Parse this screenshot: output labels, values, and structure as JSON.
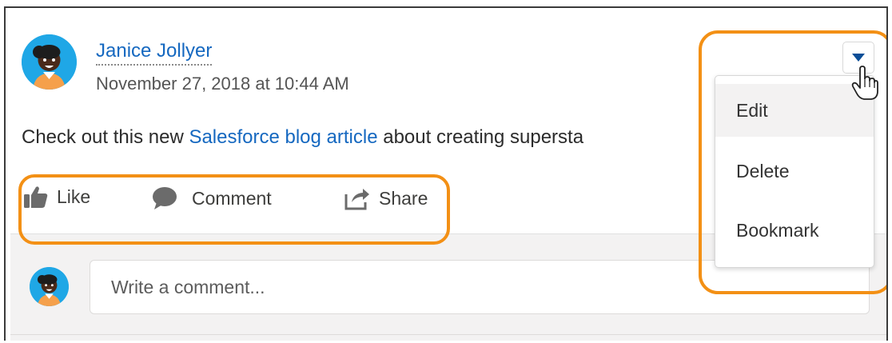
{
  "post": {
    "author": "Janice Jollyer",
    "timestamp": "November 27, 2018 at 10:44 AM",
    "body_prefix": "Check out this new ",
    "link_text": "Salesforce blog article",
    "body_suffix": " about creating supersta"
  },
  "actions": {
    "like": "Like",
    "comment": "Comment",
    "share": "Share"
  },
  "composer": {
    "placeholder": "Write a comment..."
  },
  "menu": {
    "items": [
      "Edit",
      "Delete",
      "Bookmark"
    ]
  },
  "colors": {
    "link": "#1568c0",
    "highlight": "#f39015",
    "avatar_bg": "#1fa7e6",
    "menu_trigger": "#0b4e97"
  },
  "icons": [
    "like-thumbs-up-icon",
    "comment-bubble-icon",
    "share-icon",
    "chevron-down-icon",
    "hand-pointer-cursor-icon"
  ]
}
